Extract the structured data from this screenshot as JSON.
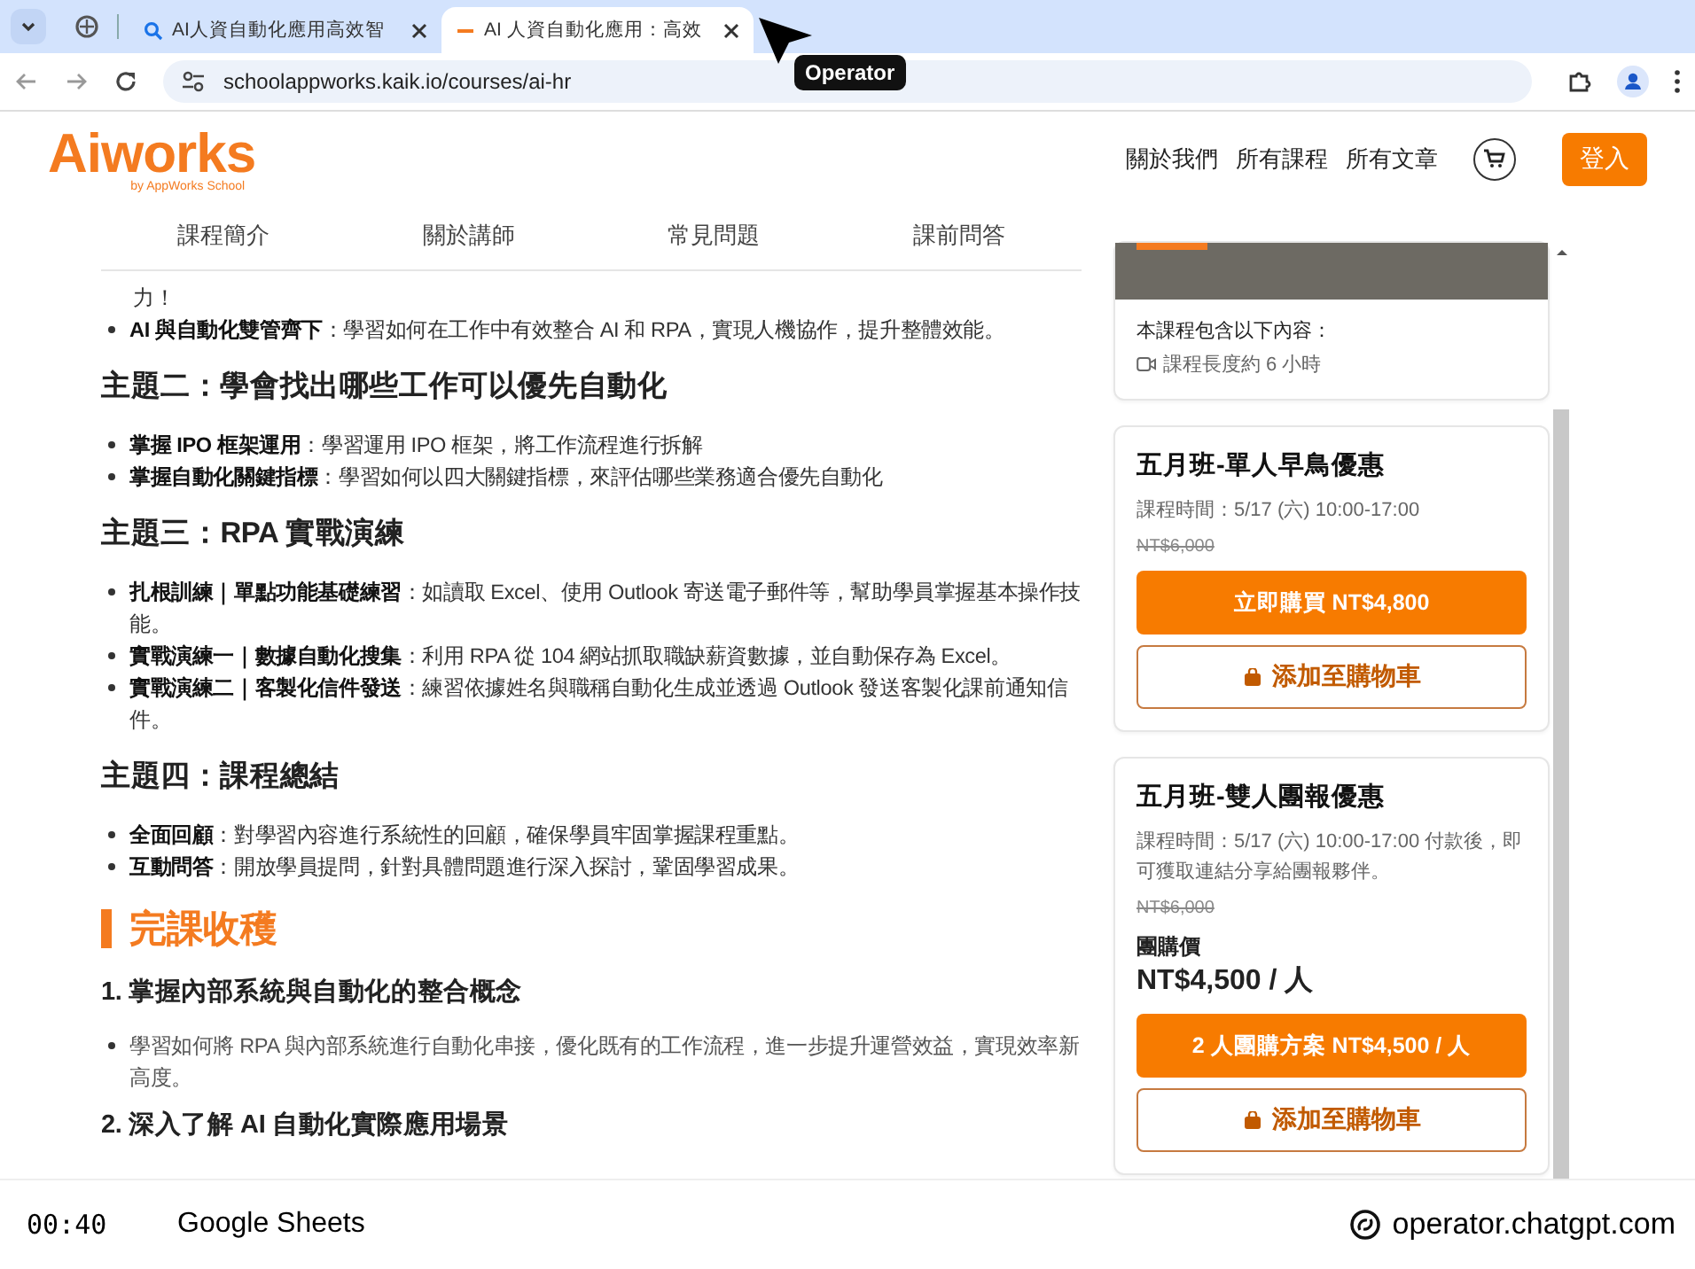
{
  "browser": {
    "tabs": [
      {
        "title": "AI人資自動化應用高效智",
        "kind": "search",
        "selected": false
      },
      {
        "title": "AI 人資自動化應用：高效",
        "kind": "dash",
        "selected": true
      }
    ],
    "url": "schoolappworks.kaik.io/courses/ai-hr",
    "tooltip": "Operator"
  },
  "header": {
    "logo": "Aiworks",
    "byline": "by AppWorks School",
    "nav": [
      "關於我們",
      "所有課程",
      "所有文章"
    ],
    "login": "登入"
  },
  "section_tabs": [
    {
      "label": "課程簡介",
      "selected": false
    },
    {
      "label": "關於講師",
      "selected": false
    },
    {
      "label": "常見問題",
      "selected": false
    },
    {
      "label": "課前問答",
      "selected": false
    }
  ],
  "content": [
    {
      "kind": "continuation",
      "text": "力！"
    },
    {
      "kind": "bullet",
      "text": "**AI 與自動化雙管齊下**：學習如何在工作中有效整合 AI 和 RPA，實現人機協作，提升整體效能。"
    },
    {
      "kind": "heading",
      "text": "主題二：學會找出哪些工作可以優先自動化"
    },
    {
      "kind": "bullet",
      "text": "**掌握 IPO 框架運用**：學習運用 IPO 框架，將工作流程進行拆解"
    },
    {
      "kind": "bullet",
      "text": "**掌握自動化關鍵指標**：學習如何以四大關鍵指標，來評估哪些業務適合優先自動化"
    },
    {
      "kind": "heading",
      "text": "主題三：RPA 實戰演練"
    },
    {
      "kind": "bullet",
      "text": "**扎根訓練｜單點功能基礎練習**：如讀取 Excel、使用 Outlook 寄送電子郵件等，幫助學員掌握基本操作技能。"
    },
    {
      "kind": "bullet",
      "text": "**實戰演練一｜數據自動化搜集**：利用 RPA 從 104 網站抓取職缺薪資數據，並自動保存為 Excel。"
    },
    {
      "kind": "bullet",
      "text": "**實戰演練二｜客製化信件發送**：練習依據姓名與職稱自動化生成並透過 Outlook 發送客製化課前通知信件。"
    },
    {
      "kind": "heading",
      "text": "主題四：課程總結"
    },
    {
      "kind": "bullet",
      "text": "**全面回顧**：對學習內容進行系統性的回顧，確保學員牢固掌握課程重點。"
    },
    {
      "kind": "bullet",
      "text": "**互動問答**：開放學員提問，針對具體問題進行深入探討，鞏固學習成果。"
    },
    {
      "kind": "section",
      "text": "完課收穫"
    },
    {
      "kind": "subheading",
      "text": "1. 掌握內部系統與自動化的整合概念"
    },
    {
      "kind": "plain_bullet",
      "text": "學習如何將 RPA 與內部系統進行自動化串接，優化既有的工作流程，進一步提升運營效益，實現效率新高度。"
    },
    {
      "kind": "subheading",
      "text": "2. 深入了解 AI 自動化實際應用場景"
    }
  ],
  "sidebar": {
    "includes_title": "本課程包含以下內容：",
    "includes": [
      "課程長度約 6 小時"
    ],
    "offers": [
      {
        "title": "五月班-單人早鳥優惠",
        "schedule": "課程時間：5/17 (六) 10:00-17:00",
        "original_price": "NT$6,000",
        "buy_button": "立即購買 NT$4,800",
        "cart_button": "添加至購物車"
      },
      {
        "title": "五月班-雙人團報優惠",
        "schedule": "課程時間：5/17 (六) 10:00-17:00 付款後，即可獲取連結分享給團報夥伴。",
        "original_price": "NT$6,000",
        "group_label": "團購價",
        "group_price": "NT$4,500 / 人",
        "buy_button": "2 人團購方案 NT$4,500 / 人",
        "cart_button": "添加至購物車"
      }
    ]
  },
  "footer": {
    "time": "00:40",
    "app": "Google Sheets",
    "brand": "operator.chatgpt.com"
  }
}
